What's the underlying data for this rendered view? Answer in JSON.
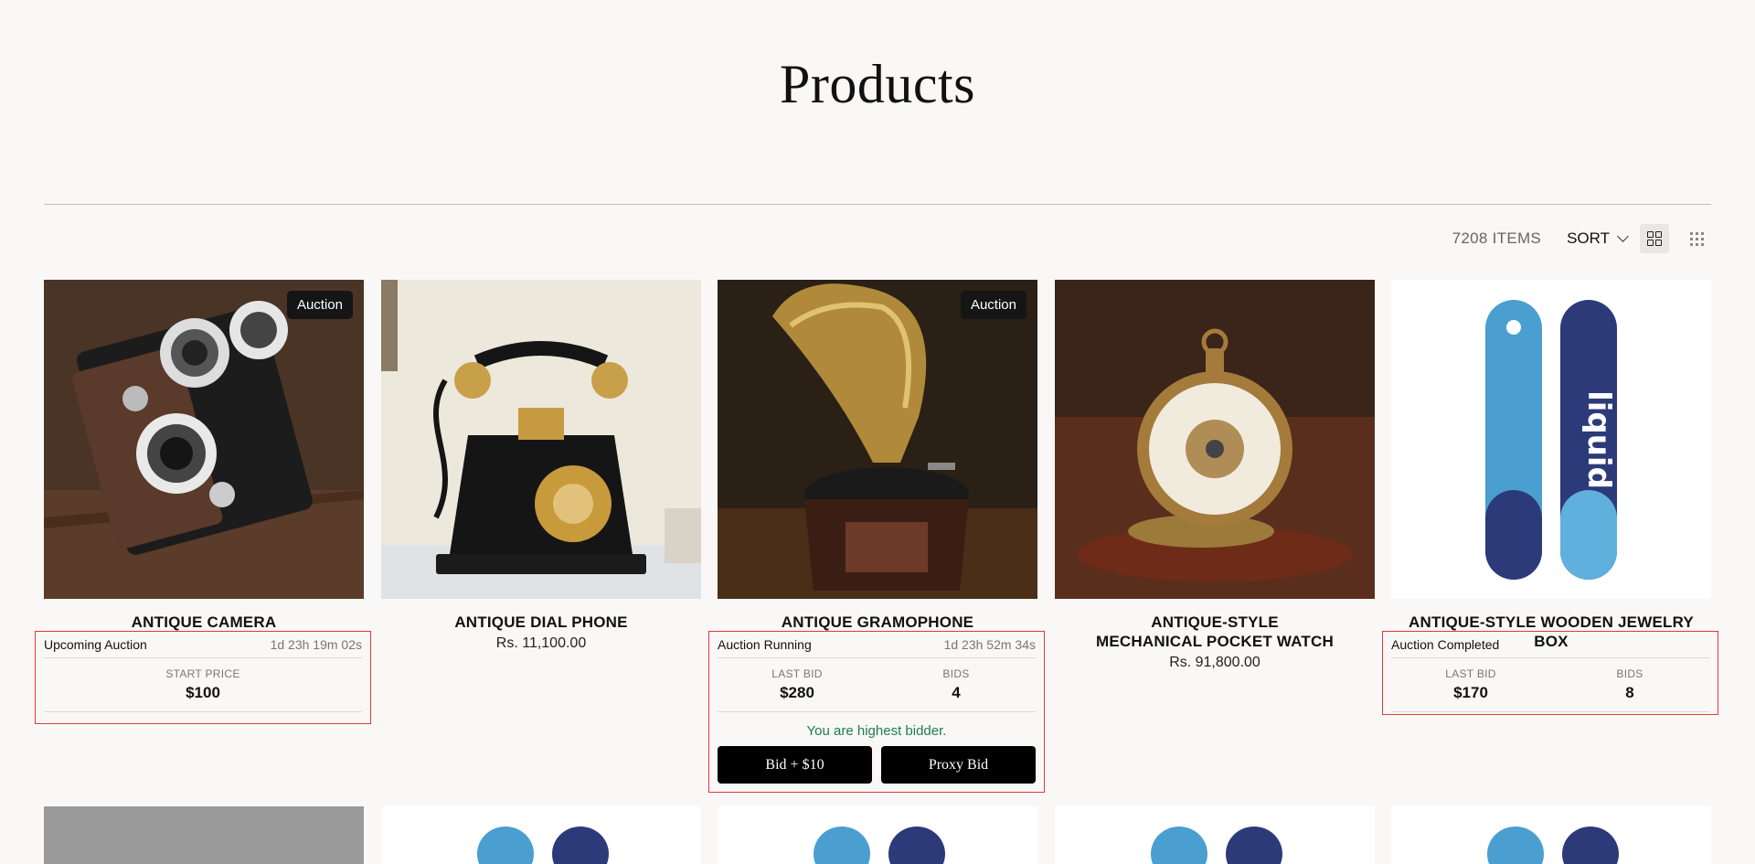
{
  "page": {
    "title": "Products"
  },
  "toolbar": {
    "item_count": "7208 ITEMS",
    "sort_label": "SORT",
    "view_options": [
      "grid-large-icon",
      "grid-small-icon"
    ]
  },
  "products": [
    {
      "name": "ANTIQUE CAMERA",
      "badge": "Auction",
      "image": "antique-twin-lens-camera",
      "auction": {
        "status": "Upcoming Auction",
        "timer": "1d 23h 19m 02s",
        "stats": [
          {
            "label": "START PRICE",
            "value": "$100"
          }
        ]
      }
    },
    {
      "name": "ANTIQUE DIAL PHONE",
      "image": "antique-dial-phone",
      "price": "Rs. 11,100.00"
    },
    {
      "name": "ANTIQUE GRAMOPHONE",
      "badge": "Auction",
      "image": "antique-gramophone",
      "auction": {
        "status": "Auction Running",
        "timer": "1d 23h 52m 34s",
        "stats": [
          {
            "label": "LAST BID",
            "value": "$280"
          },
          {
            "label": "BIDS",
            "value": "4"
          }
        ],
        "message": "You are highest bidder.",
        "buttons": [
          "Bid + $10",
          "Proxy Bid"
        ]
      }
    },
    {
      "name_line1": "ANTIQUE-STYLE",
      "name_line2": "MECHANICAL POCKET WATCH",
      "image": "pocket-watch",
      "price": "Rs. 91,800.00"
    },
    {
      "name": "ANTIQUE-STYLE WOODEN JEWELRY BOX",
      "image": "snowboards",
      "auction": {
        "status": "Auction Completed",
        "timer": "",
        "stats": [
          {
            "label": "LAST BID",
            "value": "$170"
          },
          {
            "label": "BIDS",
            "value": "8"
          }
        ]
      }
    }
  ],
  "colors": {
    "background": "#f9f8f6",
    "highlight_border": "#e53935",
    "success_text": "#1e7d4f",
    "button": "#000000"
  }
}
